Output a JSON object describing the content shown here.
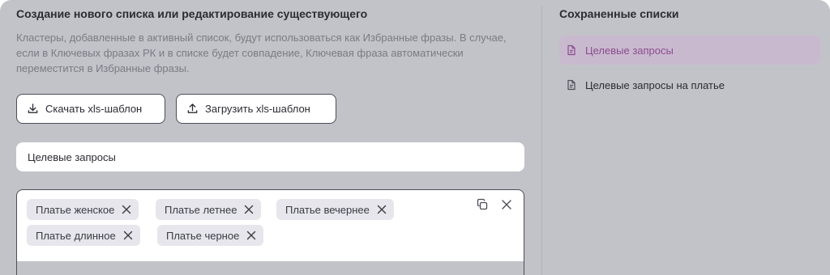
{
  "editor": {
    "title": "Создание нового списка или редактирование существующего",
    "description": "Кластеры, добавленные в активный список, будут использоваться как Избранные фразы. В случае, если в Ключевых фразах РК и в списке будет совпадение, Ключевая фраза автоматически переместится в Избранные фразы.",
    "download_label": "Скачать xls-шаблон",
    "upload_label": "Загрузить xls-шаблон",
    "list_name_value": "Целевые запросы",
    "tags": [
      {
        "label": "Платье женское"
      },
      {
        "label": "Платье летнее"
      },
      {
        "label": "Платье вечернее"
      },
      {
        "label": "Платье длинное"
      },
      {
        "label": "Платье черное"
      }
    ]
  },
  "saved": {
    "title": "Сохраненные списки",
    "items": [
      {
        "label": "Целевые запросы",
        "active": true
      },
      {
        "label": "Целевые запросы на платье",
        "active": false
      }
    ]
  },
  "colors": {
    "panel_bg": "#c2c3c8",
    "accent_active": "#8a4d8e",
    "active_bg": "#c9b9cf",
    "tag_bg": "#e6e6ec"
  },
  "icons": {
    "download": "download-icon",
    "upload": "upload-icon",
    "tag_remove": "close-icon",
    "copy": "copy-icon",
    "clear": "close-icon",
    "list_item": "document-icon"
  }
}
